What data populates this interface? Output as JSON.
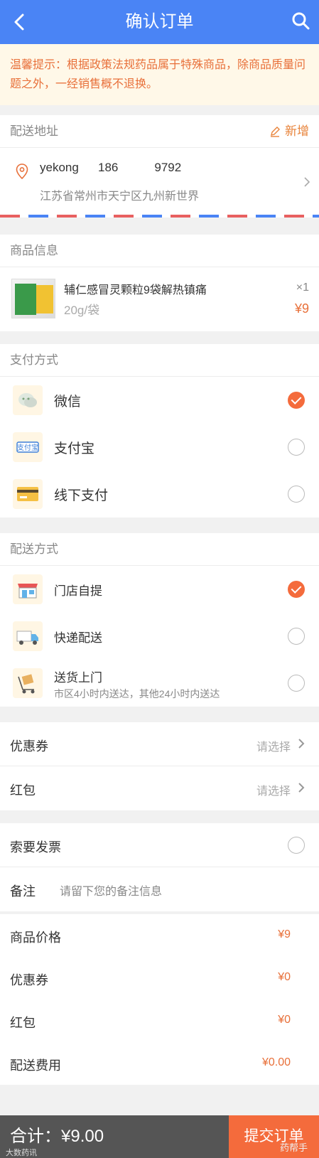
{
  "header": {
    "title": "确认订单",
    "back_icon": "chevron-left-icon",
    "search_icon": "search-icon"
  },
  "notice": "温馨提示：根据政策法规药品属于特殊商品，除商品质量问题之外，一经销售概不退换。",
  "address": {
    "section_title": "配送地址",
    "add_label": "新增",
    "name": "yekong",
    "phone": "186   9792",
    "detail": "江苏省常州市天宁区九州新世界"
  },
  "product": {
    "section_title": "商品信息",
    "name": "辅仁感冒灵颗粒9袋解热镇痛",
    "spec": "20g/袋",
    "qty": "×1",
    "price": "¥9"
  },
  "payment": {
    "section_title": "支付方式",
    "options": [
      {
        "label": "微信",
        "selected": true
      },
      {
        "label": "支付宝",
        "selected": false
      },
      {
        "label": "线下支付",
        "selected": false
      }
    ]
  },
  "delivery": {
    "section_title": "配送方式",
    "options": [
      {
        "label": "门店自提",
        "selected": true
      },
      {
        "label": "快递配送",
        "selected": false
      },
      {
        "label": "送货上门",
        "sub": "市区4小时内送达，其他24小时内送达",
        "selected": false
      }
    ]
  },
  "discounts": {
    "coupon_label": "优惠券",
    "coupon_value": "请选择",
    "redpacket_label": "红包",
    "redpacket_value": "请选择"
  },
  "invoice": {
    "label": "索要发票"
  },
  "remark": {
    "label": "备注",
    "placeholder": "请留下您的备注信息"
  },
  "summary": {
    "goods_label": "商品价格",
    "goods_value": "¥9",
    "coupon_label": "优惠券",
    "coupon_value": "¥0",
    "redpacket_label": "红包",
    "redpacket_value": "¥0",
    "shipping_label": "配送费用",
    "shipping_value": "¥0.00"
  },
  "footer": {
    "total": "合计：¥9.00",
    "submit": "提交订单"
  },
  "watermark": {
    "left": "大数药讯",
    "right": "药帮手"
  },
  "colors": {
    "primary": "#4a84f5",
    "accent": "#f46b3c",
    "price": "#e8703a"
  }
}
